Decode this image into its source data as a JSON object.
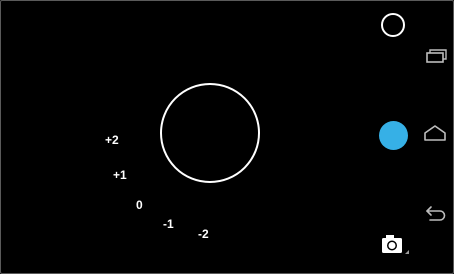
{
  "exposure": {
    "labels": [
      "+2",
      "+1",
      "0",
      "-1",
      "-2"
    ]
  },
  "controls": {
    "mode_icon": "circle-outline-icon",
    "shutter_icon": "shutter-button",
    "shutter_color": "#36b0e6",
    "switch_icon": "camera-icon"
  },
  "nav_bar": {
    "icons": [
      "recent-apps-icon",
      "home-icon",
      "back-icon"
    ]
  }
}
